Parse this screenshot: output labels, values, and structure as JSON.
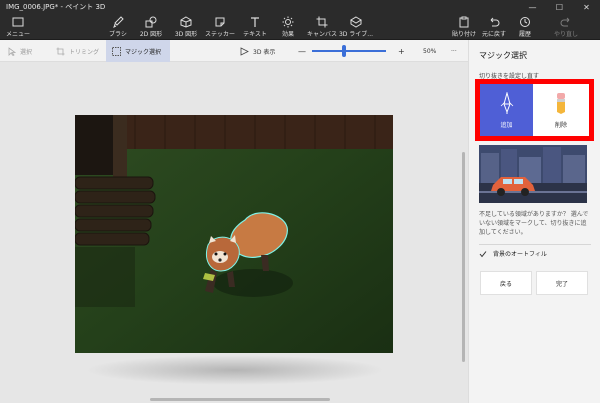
{
  "window": {
    "title": "IMG_0006.JPG* - ペイント 3D",
    "controls": [
      "—",
      "☐",
      "✕"
    ]
  },
  "ribbon": {
    "menu_label": "メニュー",
    "tools": [
      {
        "label": "ブラシ",
        "icon": "brush-icon"
      },
      {
        "label": "2D 図形",
        "icon": "2d-shapes-icon"
      },
      {
        "label": "3D 図形",
        "icon": "3d-shapes-icon"
      },
      {
        "label": "ステッカー",
        "icon": "sticker-icon"
      },
      {
        "label": "テキスト",
        "icon": "text-icon"
      },
      {
        "label": "効果",
        "icon": "effects-icon"
      },
      {
        "label": "キャンバス",
        "icon": "canvas-icon"
      },
      {
        "label": "3D ライブ...",
        "icon": "3d-library-icon"
      }
    ],
    "right_tools": [
      {
        "label": "貼り付け",
        "icon": "paste-icon"
      },
      {
        "label": "元に戻す",
        "icon": "undo-icon"
      },
      {
        "label": "履歴",
        "icon": "history-icon"
      },
      {
        "label": "やり直し",
        "icon": "redo-icon"
      }
    ]
  },
  "toolbar": {
    "select_label": "選択",
    "crop_label": "トリミング",
    "magic_select_label": "マジック選択",
    "view3d_label": "3D 表示",
    "zoom_minus": "—",
    "zoom_plus": "+",
    "zoom_level": "50%",
    "zoom_fraction": 0.43,
    "more_label": "···"
  },
  "panel": {
    "title": "マジック選択",
    "subtitle": "切り抜きを設定し直す",
    "add_label": "追加",
    "remove_label": "削除",
    "help_text": "不足している領域がありますか？ 選んでいない領域をマークして、切り抜きに追加してください。",
    "autofill_label": "背景のオートフィル",
    "autofill_checked": true,
    "back_label": "戻る",
    "done_label": "完了"
  },
  "colors": {
    "accent": "#4f5fd6",
    "highlight_border": "#ff0000",
    "ribbon_bg": "#2b2b2b",
    "panel_bg": "#f3f3f3"
  }
}
